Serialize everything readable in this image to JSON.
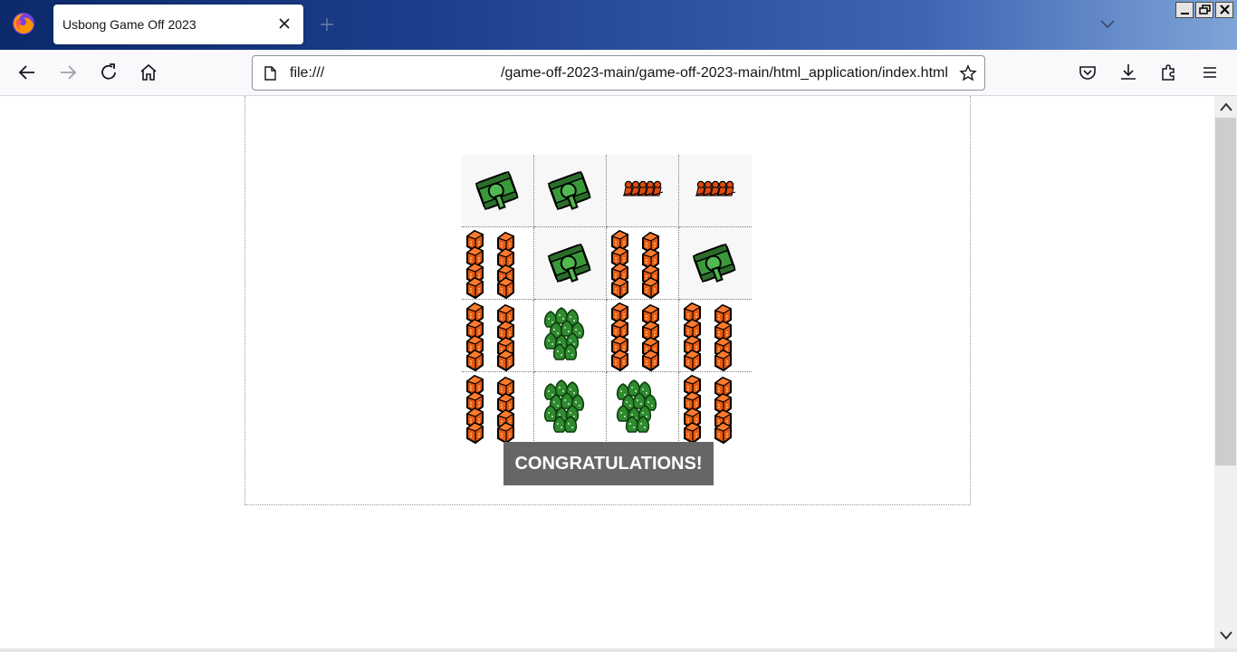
{
  "browser": {
    "tab_title": "Usbong Game Off 2023",
    "url_prefix": "file:///",
    "url_path": "/game-off-2023-main/game-off-2023-main/html_application/index.html"
  },
  "game": {
    "board": [
      [
        "tank",
        "tank",
        "soldiers",
        "soldiers"
      ],
      [
        "buildings",
        "tank",
        "buildings",
        "tank"
      ],
      [
        "buildings",
        "trees",
        "buildings",
        "buildings"
      ],
      [
        "buildings",
        "trees",
        "trees",
        "buildings"
      ]
    ],
    "message": "CONGRATULATIONS!"
  },
  "colors": {
    "building": "#e85a10",
    "tank": "#3a9a3a",
    "trees": "#2e8b2e",
    "soldiers": "#e04a10",
    "message_bg": "#666666"
  }
}
